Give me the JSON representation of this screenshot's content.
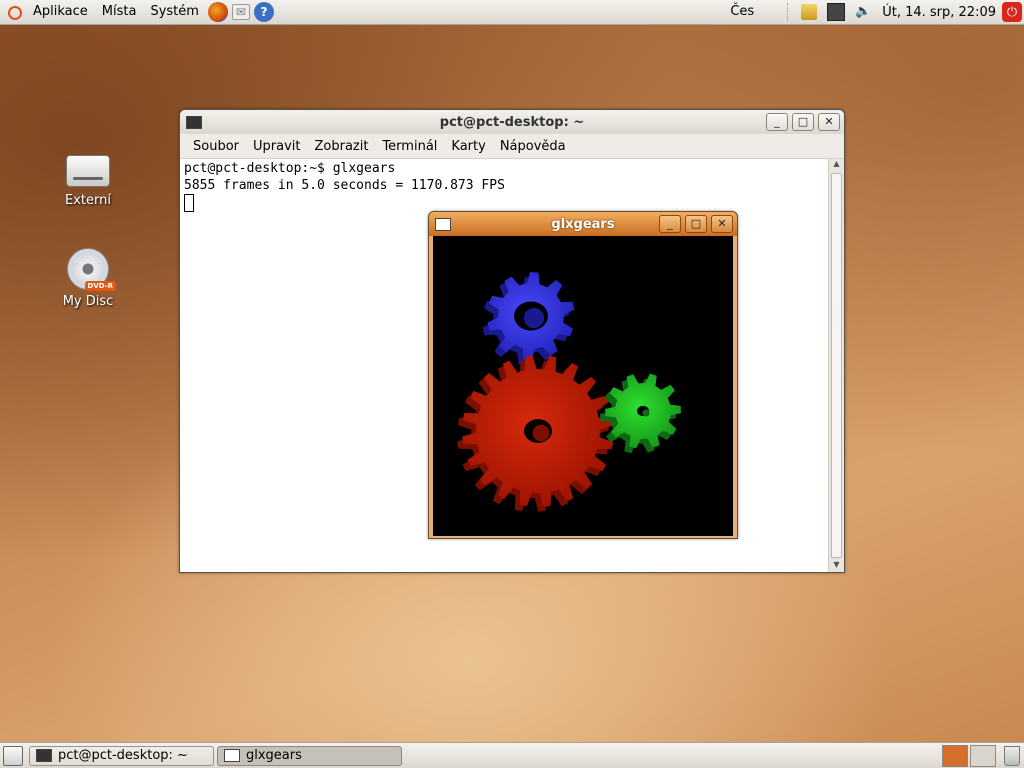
{
  "top_panel": {
    "menus": [
      "Aplikace",
      "Místa",
      "Systém"
    ],
    "keyboard_layout": "Čes",
    "clock": "Út, 14. srp, 22:09",
    "icons": [
      "ubuntu-logo",
      "firefox-icon",
      "mail-icon",
      "help-icon",
      "lock-icon",
      "network-icon",
      "volume-icon",
      "power-icon"
    ]
  },
  "desktop": {
    "icons": [
      {
        "label": "Externí",
        "icon": "drive-icon"
      },
      {
        "label": "My Disc",
        "icon": "dvd-icon",
        "badge": "DVD-R"
      }
    ]
  },
  "terminal": {
    "title": "pct@pct-desktop: ~",
    "menu": [
      "Soubor",
      "Upravit",
      "Zobrazit",
      "Terminál",
      "Karty",
      "Nápověda"
    ],
    "lines": [
      "pct@pct-desktop:~$ glxgears",
      "5855 frames in 5.0 seconds = 1170.873 FPS"
    ]
  },
  "glxgears": {
    "title": "glxgears",
    "gear_colors": {
      "red": "#c51a00",
      "green": "#1fc21f",
      "blue": "#3a3aee"
    }
  },
  "taskbar": {
    "tasks": [
      {
        "label": "pct@pct-desktop: ~",
        "active": false
      },
      {
        "label": "glxgears",
        "active": true
      }
    ]
  }
}
